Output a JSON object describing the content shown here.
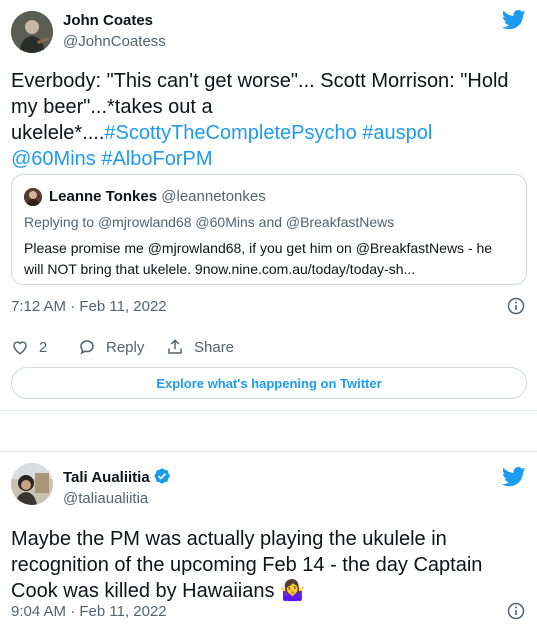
{
  "tweet1": {
    "author": {
      "name": "John Coates",
      "handle": "@JohnCoatess"
    },
    "text_parts": {
      "plain": "Everbody: \"This can't get worse\"... Scott Morrison: \"Hold my beer\"...*takes out a ukelele*....",
      "hashtags": "#ScottyTheCompletePsycho #auspol @60Mins #AlboForPM"
    },
    "quote": {
      "name": "Leanne Tonkes",
      "handle": "@leannetonkes",
      "reply_prefix": "Replying to",
      "reply_mention1": "@mjrowland68",
      "reply_mention2": "@60Mins",
      "reply_and": "and",
      "reply_mention3": "@BreakfastNews",
      "text": "Please promise me @mjrowland68, if you get him on @BreakfastNews - he will NOT bring that ukelele. 9now.nine.com.au/today/today-sh..."
    },
    "timestamp": "7:12 AM · Feb 11, 2022",
    "likes": "2",
    "reply_label": "Reply",
    "share_label": "Share",
    "explore_label": "Explore what's happening on Twitter"
  },
  "tweet2": {
    "author": {
      "name": "Tali Aualiitia",
      "handle": "@taliaualiitia"
    },
    "text": "Maybe the PM was actually playing the ukulele in recognition of the upcoming Feb 14 - the day Captain Cook was killed by Hawaiians",
    "emoji": "🤷‍♀️",
    "timestamp": "9:04 AM · Feb 11, 2022"
  },
  "colors": {
    "accent": "#1d9bf0",
    "secondary_text": "#536471",
    "border": "#cfd9de"
  },
  "icons": [
    "twitter-bird-icon",
    "info-icon",
    "heart-icon",
    "reply-icon",
    "share-icon",
    "verified-badge-icon"
  ]
}
